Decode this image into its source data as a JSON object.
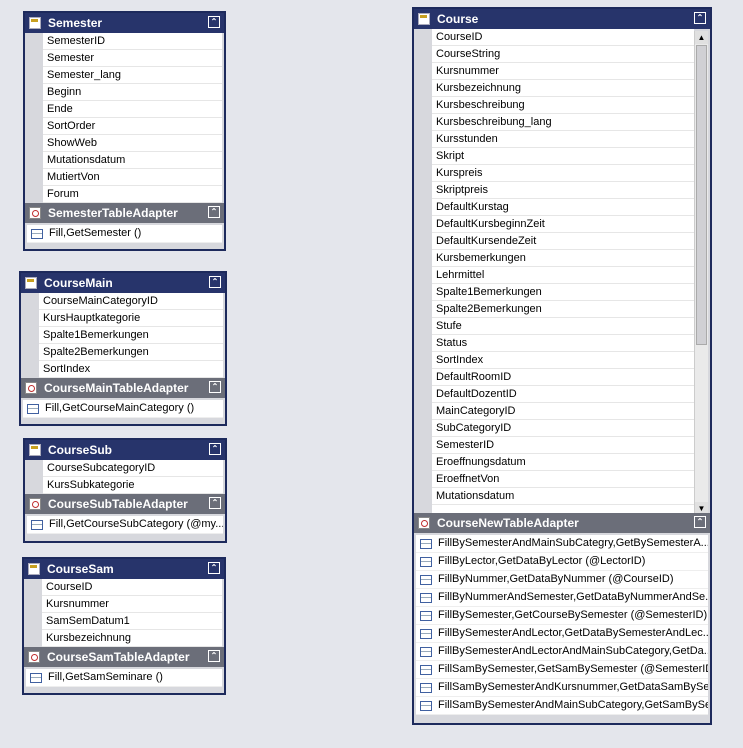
{
  "semester": {
    "title": "Semester",
    "fields": [
      "SemesterID",
      "Semester",
      "Semester_lang",
      "Beginn",
      "Ende",
      "SortOrder",
      "ShowWeb",
      "Mutationsdatum",
      "MutiertVon",
      "Forum"
    ],
    "adapter": "SemesterTableAdapter",
    "methods": [
      "Fill,GetSemester ()"
    ]
  },
  "coursemain": {
    "title": "CourseMain",
    "fields": [
      "CourseMainCategoryID",
      "KursHauptkategorie",
      "Spalte1Bemerkungen",
      "Spalte2Bemerkungen",
      "SortIndex"
    ],
    "adapter": "CourseMainTableAdapter",
    "methods": [
      "Fill,GetCourseMainCategory ()"
    ]
  },
  "coursesub": {
    "title": "CourseSub",
    "fields": [
      "CourseSubcategoryID",
      "KursSubkategorie"
    ],
    "adapter": "CourseSubTableAdapter",
    "methods": [
      "Fill,GetCourseSubCategory (@my..."
    ]
  },
  "coursesam": {
    "title": "CourseSam",
    "fields": [
      "CourseID",
      "Kursnummer",
      "SamSemDatum1",
      "Kursbezeichnung"
    ],
    "adapter": "CourseSamTableAdapter",
    "methods": [
      "Fill,GetSamSeminare ()"
    ]
  },
  "course": {
    "title": "Course",
    "fields": [
      "CourseID",
      "CourseString",
      "Kursnummer",
      "Kursbezeichnung",
      "Kursbeschreibung",
      "Kursbeschreibung_lang",
      "Kursstunden",
      "Skript",
      "Kurspreis",
      "Skriptpreis",
      "DefaultKurstag",
      "DefaultKursbeginnZeit",
      "DefaultKursendeZeit",
      "Kursbemerkungen",
      "Lehrmittel",
      "Spalte1Bemerkungen",
      "Spalte2Bemerkungen",
      "Stufe",
      "Status",
      "SortIndex",
      "DefaultRoomID",
      "DefaultDozentID",
      "MainCategoryID",
      "SubCategoryID",
      "SemesterID",
      "Eroeffnungsdatum",
      "EroeffnetVon",
      "Mutationsdatum"
    ],
    "adapter": "CourseNewTableAdapter",
    "methods": [
      "FillBySemesterAndMainSubCategry,GetBySemesterA...",
      "FillByLector,GetDataByLector (@LectorID)",
      "FillByNummer,GetDataByNummer (@CourseID)",
      "FillByNummerAndSemester,GetDataByNummerAndSe...",
      "FillBySemester,GetCourseBySemester (@SemesterID)",
      "FillBySemesterAndLector,GetDataBySemesterAndLec...",
      "FillBySemesterAndLectorAndMainSubCategory,GetDa...",
      "FillSamBySemester,GetSamBySemester (@SemesterID)",
      "FillSamBySemesterAndKursnummer,GetDataSamBySe...",
      "FillSamBySemesterAndMainSubCategory,GetSamBySe..."
    ]
  },
  "icons": {
    "table": "table-icon",
    "adapter": "table-adapter-icon",
    "key": "primary-key-icon",
    "method": "query-method-icon",
    "collapse": "collapse-chevron-icon"
  },
  "colors": {
    "header": "#27346b",
    "adapter_header": "#6b6e79",
    "background": "#e4e6ec",
    "border": "#1d2a5c"
  }
}
